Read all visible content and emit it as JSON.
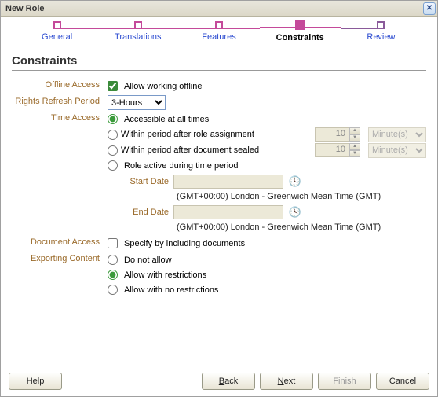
{
  "window": {
    "title": "New Role"
  },
  "steps": [
    {
      "label": "General"
    },
    {
      "label": "Translations"
    },
    {
      "label": "Features"
    },
    {
      "label": "Constraints"
    },
    {
      "label": "Review"
    }
  ],
  "section_title": "Constraints",
  "labels": {
    "offline_access": "Offline Access",
    "rights_refresh": "Rights Refresh Period",
    "time_access": "Time Access",
    "document_access": "Document Access",
    "exporting_content": "Exporting Content",
    "start_date": "Start Date",
    "end_date": "End Date"
  },
  "offline": {
    "allow_label": "Allow working offline",
    "checked": true
  },
  "refresh": {
    "value": "3-Hours"
  },
  "time_access": {
    "options": {
      "all_times": "Accessible at all times",
      "after_assignment": "Within period after role assignment",
      "after_sealed": "Within period after document sealed",
      "during_period": "Role active during time period"
    },
    "selected": "all_times",
    "after_assignment_value": "10",
    "after_assignment_unit": "Minute(s)",
    "after_sealed_value": "10",
    "after_sealed_unit": "Minute(s)",
    "timezone": "(GMT+00:00) London - Greenwich Mean Time (GMT)"
  },
  "document_access": {
    "label": "Specify by including documents",
    "checked": false
  },
  "exporting": {
    "options": {
      "none": "Do not allow",
      "restricted": "Allow with restrictions",
      "unrestricted": "Allow with no restrictions"
    },
    "selected": "restricted"
  },
  "footer": {
    "help": "Help",
    "back": "Back",
    "next": "Next",
    "finish": "Finish",
    "cancel": "Cancel"
  }
}
